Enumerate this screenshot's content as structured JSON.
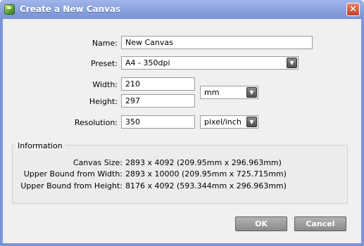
{
  "window": {
    "title": "Create a New Canvas",
    "close_glyph": "✕"
  },
  "form": {
    "name_label": "Name:",
    "name_value": "New Canvas",
    "preset_label": "Preset:",
    "preset_value": "A4 - 350dpi",
    "width_label": "Width:",
    "width_value": "210",
    "height_label": "Height:",
    "height_value": "297",
    "unit_value": "mm",
    "resolution_label": "Resolution:",
    "resolution_value": "350",
    "resolution_unit_value": "pixel/inch"
  },
  "information": {
    "legend": "Information",
    "rows": [
      {
        "label": "Canvas Size:",
        "value": "2893 x 4092 (209.95mm x 296.963mm)"
      },
      {
        "label": "Upper Bound from Width:",
        "value": "2893 x 10000 (209.95mm x 725.715mm)"
      },
      {
        "label": "Upper Bound from Height:",
        "value": "8176 x 4092 (593.344mm x 296.963mm)"
      }
    ]
  },
  "buttons": {
    "ok": "OK",
    "cancel": "Cancel"
  },
  "colors": {
    "titlebar": "#7b96d6",
    "close": "#c1412a",
    "button": "#9a9a9a"
  },
  "icons": {
    "app": "app-icon",
    "dropdown": "chevron-down-icon",
    "close": "close-icon"
  }
}
